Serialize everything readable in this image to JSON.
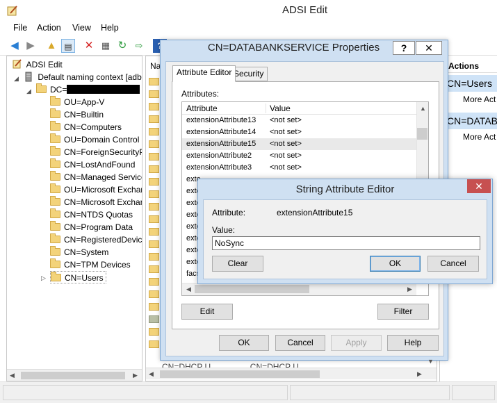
{
  "app": {
    "title": "ADSI Edit",
    "menu": [
      "File",
      "Action",
      "View",
      "Help"
    ]
  },
  "toolbar": {
    "icons": [
      "back-icon",
      "forward-icon",
      "up-folder-icon",
      "show-hide-tree-icon",
      "delete-icon",
      "properties-icon",
      "refresh-icon",
      "export-icon",
      "help-icon"
    ]
  },
  "tree": {
    "root": "ADSI Edit",
    "context": "Default naming context [adb",
    "dc": "DC=",
    "items": [
      "OU=App-V",
      "CN=Builtin",
      "CN=Computers",
      "OU=Domain Control",
      "CN=ForeignSecurityP",
      "CN=LostAndFound",
      "CN=Managed Service",
      "OU=Microsoft Exchar",
      "CN=Microsoft Exchar",
      "CN=NTDS Quotas",
      "CN=Program Data",
      "CN=RegisteredDevice",
      "CN=System",
      "CN=TPM Devices",
      "CN=Users"
    ]
  },
  "list": {
    "header": "Na",
    "bottom_row": "CN=DHCP U...              CN=DHCP U..."
  },
  "actions": {
    "header": "Actions",
    "section1": "CN=Users",
    "item1": "More Act",
    "section2": "CN=DATAB",
    "item2": "More Act"
  },
  "props": {
    "title": "CN=DATABANKSERVICE Properties",
    "help_glyph": "?",
    "close_glyph": "✕",
    "tabs": [
      "Attribute Editor",
      "Security"
    ],
    "attributes_label": "Attributes:",
    "col_attribute": "Attribute",
    "col_value": "Value",
    "rows": [
      {
        "name": "extensionAttribute13",
        "value": "<not set>"
      },
      {
        "name": "extensionAttribute14",
        "value": "<not set>"
      },
      {
        "name": "extensionAttribute15",
        "value": "<not set>"
      },
      {
        "name": "extensionAttribute2",
        "value": "<not set>"
      },
      {
        "name": "extensionAttribute3",
        "value": "<not set>"
      },
      {
        "name": "exte",
        "value": ""
      },
      {
        "name": "exte",
        "value": ""
      },
      {
        "name": "exte",
        "value": ""
      },
      {
        "name": "exte",
        "value": ""
      },
      {
        "name": "exte",
        "value": ""
      },
      {
        "name": "exte",
        "value": ""
      },
      {
        "name": "exte",
        "value": ""
      },
      {
        "name": "exte",
        "value": ""
      },
      {
        "name": "facs",
        "value": ""
      }
    ],
    "edit_button": "Edit",
    "filter_button": "Filter",
    "ok_button": "OK",
    "cancel_button": "Cancel",
    "apply_button": "Apply",
    "help_button": "Help"
  },
  "sae": {
    "title": "String Attribute Editor",
    "close_glyph": "✕",
    "attribute_label": "Attribute:",
    "attribute_value": "extensionAttribute15",
    "value_label": "Value:",
    "value": "NoSync",
    "clear_button": "Clear",
    "ok_button": "OK",
    "cancel_button": "Cancel"
  },
  "colors": {
    "dialog_frame": "#cfe0f2",
    "selected_section": "#cfe3f7",
    "close_red": "#c75050",
    "folder": "#f3d37a"
  }
}
